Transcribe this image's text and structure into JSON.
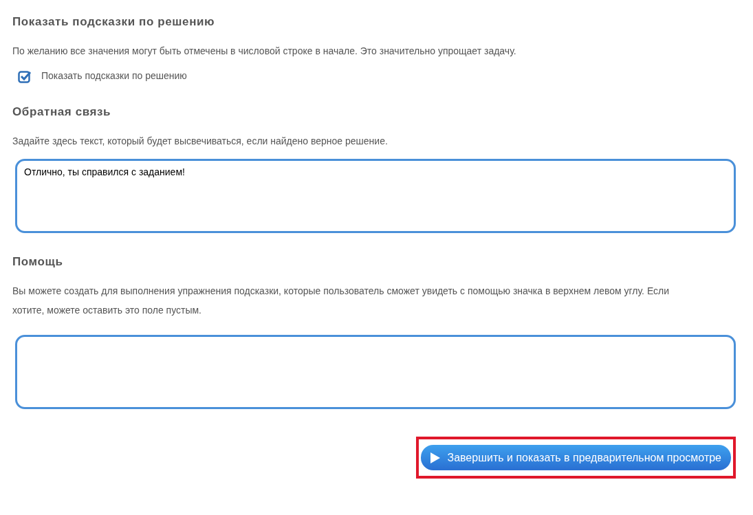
{
  "sections": [
    {
      "kind": "checkbox",
      "title": "Показать подсказки по решению",
      "description": "По желанию все значения могут быть отмечены в числовой строке в начале. Это значительно упрощает задачу.",
      "checkbox": {
        "label": "Показать подсказки по решению",
        "checked": true
      }
    },
    {
      "kind": "textarea",
      "title": "Обратная связь",
      "description": "Задайте здесь текст, который будет высвечиваться, если найдено верное решение.",
      "value": "Отлично, ты справился с заданием!"
    },
    {
      "kind": "textarea",
      "title": "Помощь",
      "description": "Вы можете создать для выполнения упражнения подсказки, которые пользователь сможет увидеть с помощью значка в верхнем левом углу. Если хотите, можете оставить это поле пустым."
    }
  ],
  "button": {
    "label": "Завершить и показать в предварительном просмотре",
    "highlighted": true
  }
}
